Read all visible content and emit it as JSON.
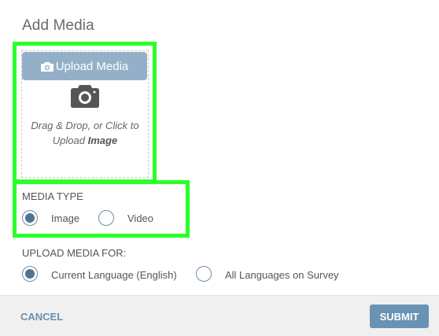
{
  "dialog": {
    "title": "Add Media"
  },
  "upload": {
    "button_label": "Upload Media",
    "drop_text_line1": "Drag & Drop, or Click to",
    "drop_text_line2_prefix": "Upload ",
    "drop_text_line2_bold": "Image",
    "icon": "camera-icon"
  },
  "media_type": {
    "label": "MEDIA TYPE",
    "options": [
      {
        "label": "Image",
        "checked": true
      },
      {
        "label": "Video",
        "checked": false
      }
    ]
  },
  "upload_for": {
    "label": "UPLOAD MEDIA FOR:",
    "options": [
      {
        "label": "Current Language (English)",
        "checked": true
      },
      {
        "label": "All Languages on Survey",
        "checked": false
      }
    ]
  },
  "footer": {
    "cancel_label": "CANCEL",
    "submit_label": "SUBMIT"
  },
  "colors": {
    "highlight": "#2bff2b",
    "upload_button": "#93b0c8",
    "submit_button": "#6a93b3",
    "radio_accent": "#4e7492"
  }
}
